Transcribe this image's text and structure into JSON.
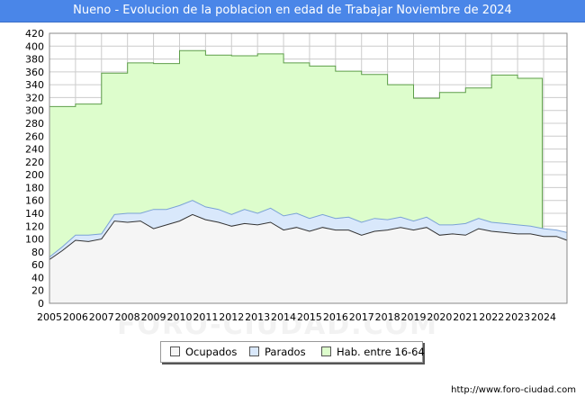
{
  "title": "Nueno - Evolucion de la poblacion en edad de Trabajar Noviembre de 2024",
  "source_url": "http://www.foro-ciudad.com",
  "watermark": "FORO-CIUDAD.COM",
  "colors": {
    "title_bar": "#4a86e8",
    "hab_fill": "#ddfdcc",
    "hab_line": "#5e9e4a",
    "parados_fill": "#d9e8fb",
    "parados_line": "#7ba2d6",
    "ocupados_fill": "#f5f5f5",
    "ocupados_line": "#333333",
    "grid": "#cccccc"
  },
  "legend": {
    "placement": "bottom-center",
    "items": [
      {
        "label": "Ocupados",
        "color": "#f5f5f5"
      },
      {
        "label": "Parados",
        "color": "#d9e8fb"
      },
      {
        "label": "Hab. entre 16-64",
        "color": "#ddfdcc"
      }
    ]
  },
  "chart_data": {
    "type": "area",
    "title": "Nueno - Evolucion de la poblacion en edad de Trabajar Noviembre de 2024",
    "xlabel": "",
    "ylabel": "",
    "x_ticks": [
      "2005",
      "2006",
      "2007",
      "2008",
      "2009",
      "2010",
      "2011",
      "2012",
      "2013",
      "2014",
      "2015",
      "2016",
      "2017",
      "2018",
      "2019",
      "2020",
      "2021",
      "2022",
      "2023",
      "2024"
    ],
    "y_ticks": [
      0,
      20,
      40,
      60,
      80,
      100,
      120,
      140,
      160,
      180,
      200,
      220,
      240,
      260,
      280,
      300,
      320,
      340,
      360,
      380,
      400,
      420
    ],
    "xlim": [
      2005,
      2024.9
    ],
    "ylim": [
      0,
      420
    ],
    "grid": true,
    "series": [
      {
        "name": "Hab. entre 16-64",
        "step": true,
        "x": [
          2005,
          2006,
          2007,
          2008,
          2009,
          2010,
          2011,
          2012,
          2013,
          2014,
          2015,
          2016,
          2017,
          2018,
          2019,
          2020,
          2021,
          2022,
          2023,
          2023.95
        ],
        "values": [
          306,
          310,
          358,
          374,
          373,
          393,
          386,
          385,
          388,
          374,
          369,
          361,
          356,
          340,
          319,
          328,
          335,
          355,
          350,
          110
        ]
      },
      {
        "name": "Parados",
        "x": [
          2005,
          2005.5,
          2006,
          2006.5,
          2007,
          2007.5,
          2008,
          2008.5,
          2009,
          2009.5,
          2010,
          2010.5,
          2011,
          2011.5,
          2012,
          2012.5,
          2013,
          2013.5,
          2014,
          2014.5,
          2015,
          2015.5,
          2016,
          2016.5,
          2017,
          2017.5,
          2018,
          2018.5,
          2019,
          2019.5,
          2020,
          2020.5,
          2021,
          2021.5,
          2022,
          2022.5,
          2023,
          2023.5,
          2024,
          2024.5,
          2024.9
        ],
        "values": [
          72,
          88,
          106,
          106,
          108,
          138,
          140,
          140,
          146,
          146,
          152,
          160,
          150,
          146,
          138,
          146,
          140,
          148,
          136,
          140,
          132,
          138,
          132,
          134,
          126,
          132,
          130,
          134,
          128,
          134,
          122,
          122,
          124,
          132,
          126,
          124,
          122,
          120,
          116,
          114,
          110
        ]
      },
      {
        "name": "Ocupados",
        "x": [
          2005,
          2005.5,
          2006,
          2006.5,
          2007,
          2007.5,
          2008,
          2008.5,
          2009,
          2009.5,
          2010,
          2010.5,
          2011,
          2011.5,
          2012,
          2012.5,
          2013,
          2013.5,
          2014,
          2014.5,
          2015,
          2015.5,
          2016,
          2016.5,
          2017,
          2017.5,
          2018,
          2018.5,
          2019,
          2019.5,
          2020,
          2020.5,
          2021,
          2021.5,
          2022,
          2022.5,
          2023,
          2023.5,
          2024,
          2024.5,
          2024.9
        ],
        "values": [
          68,
          82,
          98,
          96,
          100,
          128,
          126,
          128,
          116,
          122,
          128,
          138,
          130,
          126,
          120,
          124,
          122,
          126,
          114,
          118,
          112,
          118,
          114,
          114,
          106,
          112,
          114,
          118,
          114,
          118,
          106,
          108,
          106,
          116,
          112,
          110,
          108,
          108,
          104,
          104,
          98
        ]
      }
    ]
  }
}
